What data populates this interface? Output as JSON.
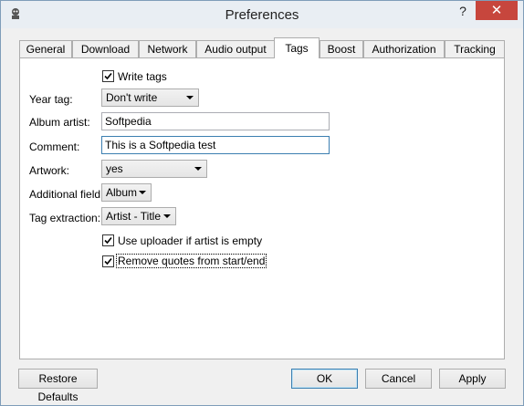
{
  "window": {
    "title": "Preferences",
    "help_label": "?",
    "close_label": "✕"
  },
  "tabs": [
    {
      "label": "General"
    },
    {
      "label": "Download"
    },
    {
      "label": "Network"
    },
    {
      "label": "Audio output"
    },
    {
      "label": "Tags",
      "active": true
    },
    {
      "label": "Boost"
    },
    {
      "label": "Authorization"
    },
    {
      "label": "Tracking"
    }
  ],
  "tags": {
    "write_tags": {
      "label": "Write tags",
      "checked": true
    },
    "year_tag": {
      "label": "Year tag:",
      "value": "Don't write"
    },
    "album_artist": {
      "label": "Album artist:",
      "value": "Softpedia"
    },
    "comment": {
      "label": "Comment:",
      "value": "This is a Softpedia test"
    },
    "artwork": {
      "label": "Artwork:",
      "value": "yes"
    },
    "additional_field": {
      "label": "Additional field:",
      "value": "Album"
    },
    "tag_extraction": {
      "label": "Tag extraction:",
      "value": "Artist - Title"
    },
    "use_uploader": {
      "label": "Use uploader if artist is empty",
      "checked": true
    },
    "remove_quotes": {
      "label": "Remove quotes from start/end",
      "checked": true
    }
  },
  "footer": {
    "restore_label": "Restore Defaults",
    "ok_label": "OK",
    "cancel_label": "Cancel",
    "apply_label": "Apply"
  },
  "colors": {
    "close_button": "#c7463d",
    "focus_border": "#3c7fb1"
  }
}
